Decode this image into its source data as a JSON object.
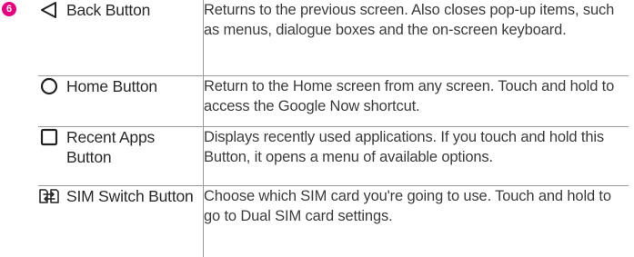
{
  "step_marker": "6",
  "keys": [
    {
      "icon": "back-triangle-icon",
      "name": "Back Button",
      "description": "Returns to the previous screen. Also closes pop-up items, such as menus, dialogue boxes and the on-screen keyboard."
    },
    {
      "icon": "home-circle-icon",
      "name": "Home Button",
      "description": "Return to the Home screen from any screen. Touch and hold to access the Google Now shortcut."
    },
    {
      "icon": "recent-apps-square-icon",
      "name": "Recent Apps Button",
      "description": "Displays recently used applications. If you touch and hold this Button, it opens a menu of available options."
    },
    {
      "icon": "sim-switch-icon",
      "name": "SIM Switch Button",
      "description": "Choose which SIM card you're going to use. Touch and hold to go to Dual SIM card settings."
    }
  ],
  "colors": {
    "marker": "#e6007e",
    "rule": "#9a9a9a",
    "text": "#3c3c3c"
  }
}
